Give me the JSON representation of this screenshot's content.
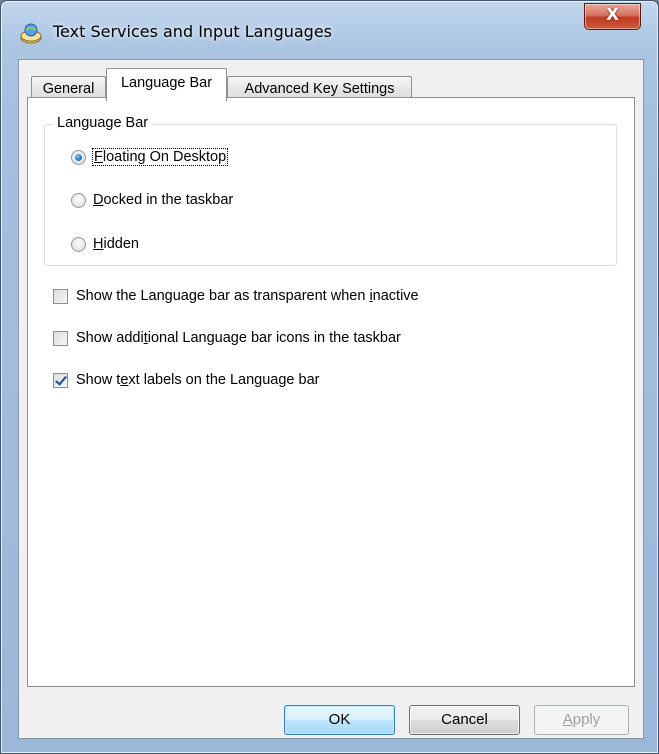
{
  "window": {
    "title": "Text Services and Input Languages",
    "close_label": "X"
  },
  "tabs": [
    {
      "label": "General",
      "active": false
    },
    {
      "label": "Language Bar",
      "active": true
    },
    {
      "label": "Advanced Key Settings",
      "active": false
    }
  ],
  "language_bar_group": {
    "legend": "Language Bar",
    "options": [
      {
        "label_prefix": "",
        "accel": "F",
        "label_rest": "loating On Desktop",
        "checked": true
      },
      {
        "label_prefix": "",
        "accel": "D",
        "label_rest": "ocked in the taskbar",
        "checked": false
      },
      {
        "label_prefix": "",
        "accel": "H",
        "label_rest": "idden",
        "checked": false
      }
    ]
  },
  "checkboxes": [
    {
      "label_prefix": "Show the Language bar as transparent when ",
      "accel": "i",
      "label_rest": "nactive",
      "checked": false
    },
    {
      "label_prefix": "Show addi",
      "accel": "t",
      "label_rest": "ional Language bar icons in the taskbar",
      "checked": false
    },
    {
      "label_prefix": "Show t",
      "accel": "e",
      "label_rest": "xt labels on the Language bar",
      "checked": true
    }
  ],
  "buttons": {
    "ok": "OK",
    "cancel": "Cancel",
    "apply_accel": "A",
    "apply_rest": "pply"
  },
  "colors": {
    "window_frame": "#a5c0dd",
    "close_button": "#c13a23",
    "radio_selected": "#1e78c8",
    "default_button": "#bee6fd"
  }
}
